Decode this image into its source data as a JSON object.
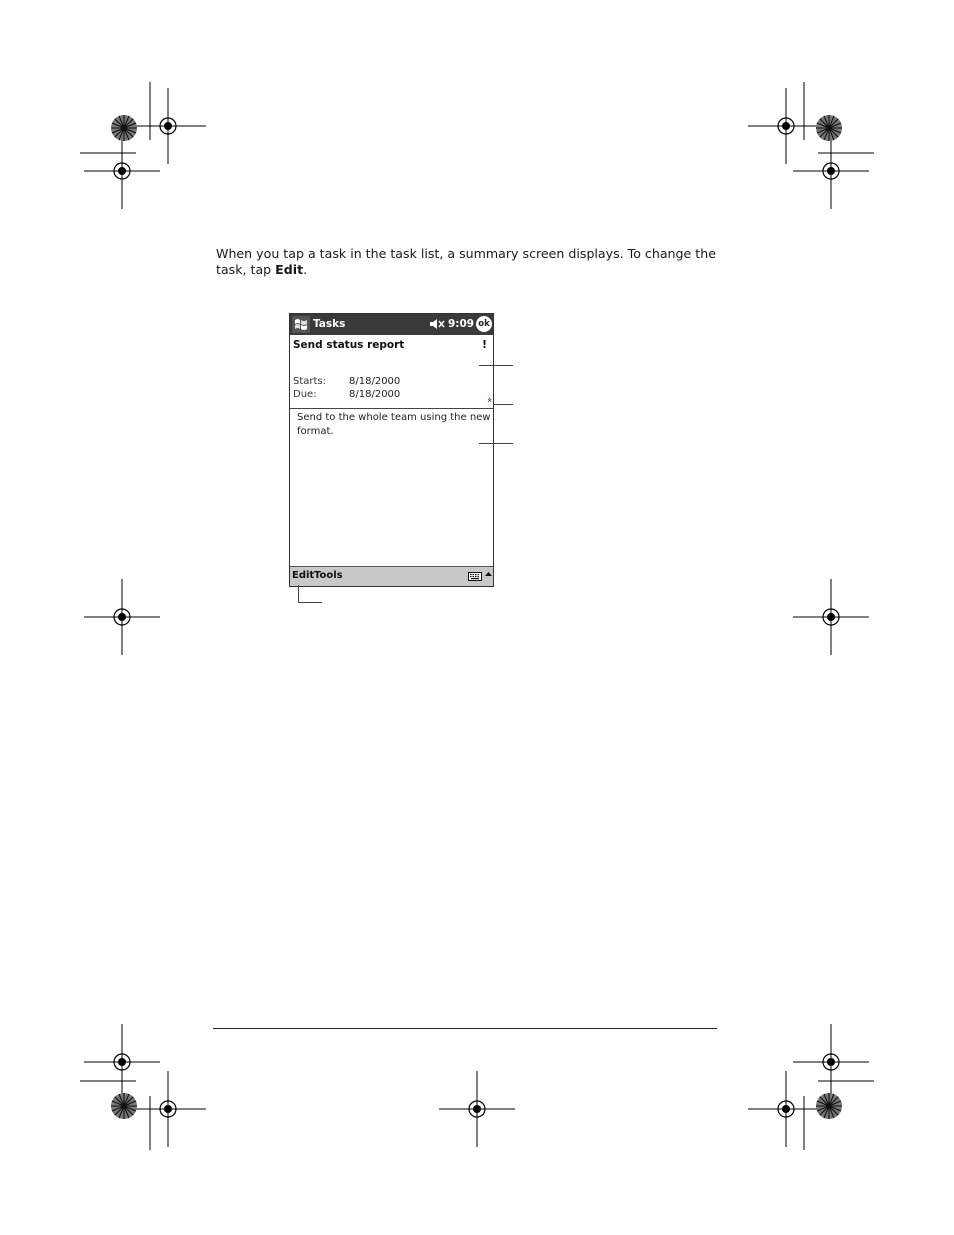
{
  "intro": {
    "text_before": "When you tap a task in the task list, a summary screen displays. To change the task, tap ",
    "bold": "Edit",
    "text_after": "."
  },
  "device": {
    "app_title": "Tasks",
    "time": "9:09",
    "ok_label": "ok",
    "task_name": "Send status report",
    "priority_mark": "!",
    "starts_label": "Starts:",
    "starts_value": "8/18/2000",
    "due_label": "Due:",
    "due_value": "8/18/2000",
    "collapse_glyph": "«",
    "notes": "Send to the whole team using the new format.",
    "menu": {
      "edit": "Edit",
      "tools": "Tools"
    },
    "icons": [
      "start-flag-icon",
      "speaker-muted-icon",
      "keyboard-icon",
      "up-arrow-icon"
    ]
  }
}
